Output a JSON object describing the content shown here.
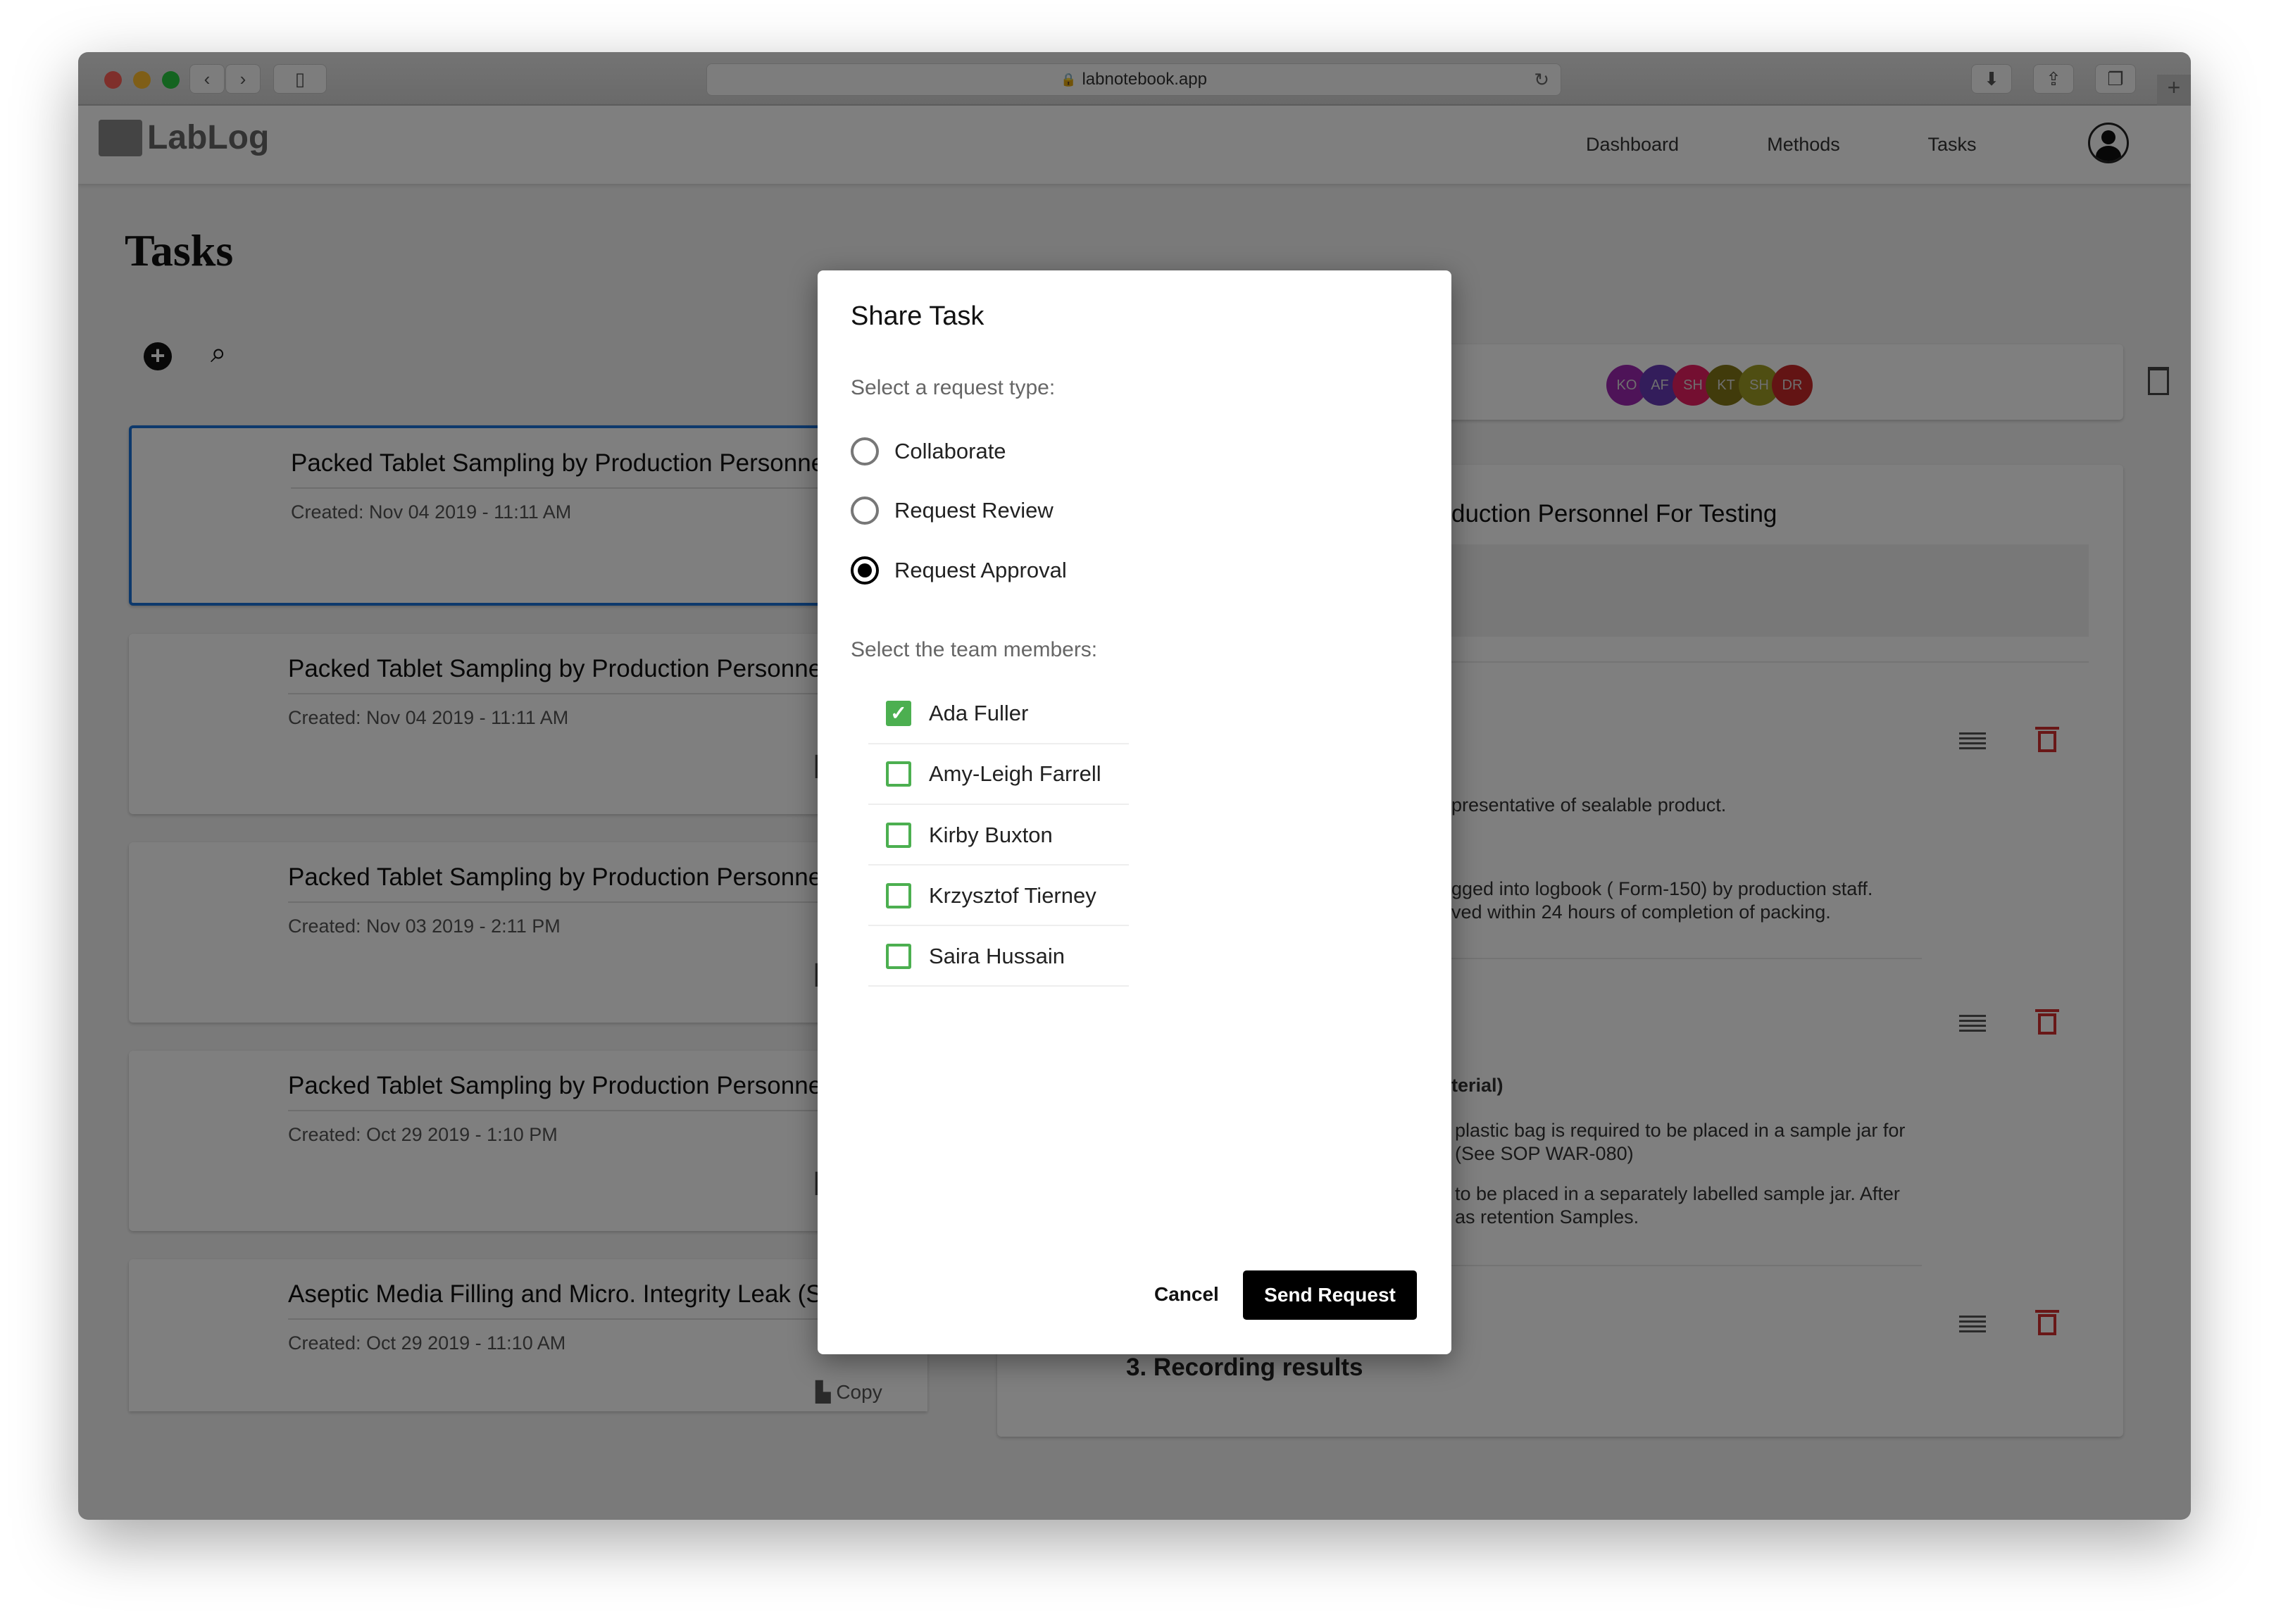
{
  "browser": {
    "url": "labnotebook.app"
  },
  "app": {
    "logo": "LabLog",
    "nav": [
      "Dashboard",
      "Methods",
      "Tasks"
    ],
    "page_title": "Tasks"
  },
  "tasks": [
    {
      "title": "Packed Tablet Sampling by Production Personnel For Testing",
      "created": "Created: Nov 04 2019 - 11:11 AM",
      "selected": true
    },
    {
      "title": "Packed Tablet Sampling by Production Personnel For Testing",
      "created": "Created: Nov 04 2019 - 11:11 AM"
    },
    {
      "title": "Packed Tablet Sampling by Production Personnel For Testing",
      "created": "Created: Nov 03 2019 - 2:11 PM"
    },
    {
      "title": "Packed Tablet Sampling by Production Personnel For Testing",
      "created": "Created: Oct 29 2019 - 1:10 PM"
    },
    {
      "title": "Aseptic Media Filling and Micro. Integrity Leak (Soup) Test",
      "created": "Created: Oct 29 2019 - 11:10 AM",
      "copy_label": "Copy"
    }
  ],
  "detail": {
    "avatars": [
      {
        "initials": "KO",
        "color": "#9c27b0"
      },
      {
        "initials": "AF",
        "color": "#673ab7"
      },
      {
        "initials": "SH",
        "color": "#e91e63"
      },
      {
        "initials": "KT",
        "color": "#827717"
      },
      {
        "initials": "SH",
        "color": "#9e9d24"
      },
      {
        "initials": "DR",
        "color": "#c62828"
      }
    ],
    "title_fragment": "duction Personnel For Testing",
    "step1_text": "presentative of sealable product.",
    "step1_text2a": "gged into logbook ( Form-150) by production staff.",
    "step1_text2b": "ved within 24 hours of completion of packing.",
    "step2_heading": "terial)",
    "step2_text1a": "plastic bag is required to be placed in a sample jar for",
    "step2_text1b": "(See SOP WAR-080)",
    "step2_text2a": "to be placed in a separately labelled sample jar. After",
    "step2_text2b": "as retention Samples.",
    "step3_heading": "3. Recording results"
  },
  "modal": {
    "title": "Share Task",
    "request_type_label": "Select a request type:",
    "request_types": [
      {
        "label": "Collaborate",
        "selected": false
      },
      {
        "label": "Request Review",
        "selected": false
      },
      {
        "label": "Request Approval",
        "selected": true
      }
    ],
    "members_label": "Select the team members:",
    "members": [
      {
        "name": "Ada Fuller",
        "checked": true
      },
      {
        "name": "Amy-Leigh Farrell",
        "checked": false
      },
      {
        "name": "Kirby Buxton",
        "checked": false
      },
      {
        "name": "Krzysztof Tierney",
        "checked": false
      },
      {
        "name": "Saira Hussain",
        "checked": false
      }
    ],
    "cancel": "Cancel",
    "send": "Send Request"
  }
}
